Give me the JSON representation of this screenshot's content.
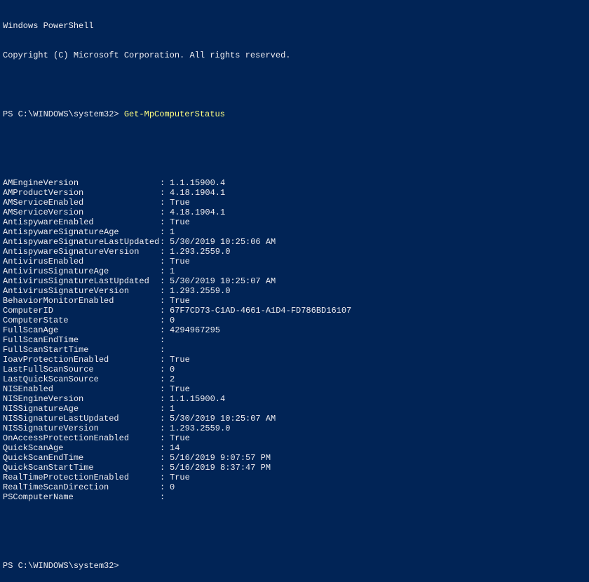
{
  "header": {
    "title": "Windows PowerShell",
    "copyright": "Copyright (C) Microsoft Corporation. All rights reserved."
  },
  "prompt1_prefix": "PS C:\\WINDOWS\\system32> ",
  "command": "Get-MpComputerStatus",
  "prompt2": "PS C:\\WINDOWS\\system32>",
  "kv": [
    {
      "k": "AMEngineVersion",
      "v": "1.1.15900.4"
    },
    {
      "k": "AMProductVersion",
      "v": "4.18.1904.1"
    },
    {
      "k": "AMServiceEnabled",
      "v": "True"
    },
    {
      "k": "AMServiceVersion",
      "v": "4.18.1904.1"
    },
    {
      "k": "AntispywareEnabled",
      "v": "True"
    },
    {
      "k": "AntispywareSignatureAge",
      "v": "1"
    },
    {
      "k": "AntispywareSignatureLastUpdated",
      "v": "5/30/2019 10:25:06 AM"
    },
    {
      "k": "AntispywareSignatureVersion",
      "v": "1.293.2559.0"
    },
    {
      "k": "AntivirusEnabled",
      "v": "True"
    },
    {
      "k": "AntivirusSignatureAge",
      "v": "1"
    },
    {
      "k": "AntivirusSignatureLastUpdated",
      "v": "5/30/2019 10:25:07 AM"
    },
    {
      "k": "AntivirusSignatureVersion",
      "v": "1.293.2559.0"
    },
    {
      "k": "BehaviorMonitorEnabled",
      "v": "True"
    },
    {
      "k": "ComputerID",
      "v": "67F7CD73-C1AD-4661-A1D4-FD786BD16107"
    },
    {
      "k": "ComputerState",
      "v": "0"
    },
    {
      "k": "FullScanAge",
      "v": "4294967295"
    },
    {
      "k": "FullScanEndTime",
      "v": ""
    },
    {
      "k": "FullScanStartTime",
      "v": ""
    },
    {
      "k": "IoavProtectionEnabled",
      "v": "True"
    },
    {
      "k": "LastFullScanSource",
      "v": "0"
    },
    {
      "k": "LastQuickScanSource",
      "v": "2"
    },
    {
      "k": "NISEnabled",
      "v": "True"
    },
    {
      "k": "NISEngineVersion",
      "v": "1.1.15900.4"
    },
    {
      "k": "NISSignatureAge",
      "v": "1"
    },
    {
      "k": "NISSignatureLastUpdated",
      "v": "5/30/2019 10:25:07 AM"
    },
    {
      "k": "NISSignatureVersion",
      "v": "1.293.2559.0"
    },
    {
      "k": "OnAccessProtectionEnabled",
      "v": "True"
    },
    {
      "k": "QuickScanAge",
      "v": "14"
    },
    {
      "k": "QuickScanEndTime",
      "v": "5/16/2019 9:07:57 PM"
    },
    {
      "k": "QuickScanStartTime",
      "v": "5/16/2019 8:37:47 PM"
    },
    {
      "k": "RealTimeProtectionEnabled",
      "v": "True"
    },
    {
      "k": "RealTimeScanDirection",
      "v": "0"
    },
    {
      "k": "PSComputerName",
      "v": ""
    }
  ]
}
